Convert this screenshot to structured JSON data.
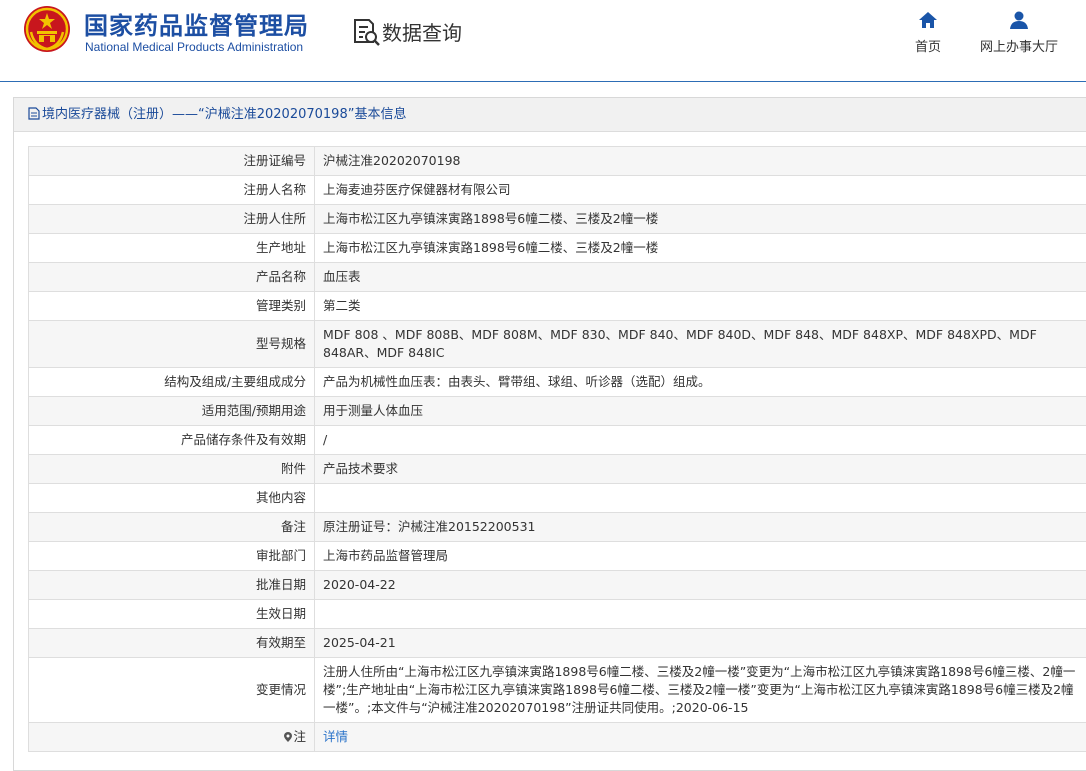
{
  "header": {
    "brand_cn": "国家药品监督管理局",
    "brand_en": "National Medical Products Administration",
    "query_title": "数据查询",
    "nav": [
      {
        "label": "首页",
        "icon": "home-icon"
      },
      {
        "label": "网上办事大厅",
        "icon": "user-icon"
      }
    ]
  },
  "panel": {
    "title": "境内医疗器械（注册）——“沪械注准20202070198”基本信息",
    "title_icon": "document-icon"
  },
  "rows": [
    {
      "label": "注册证编号",
      "value": "沪械注准20202070198"
    },
    {
      "label": "注册人名称",
      "value": "上海麦迪芬医疗保健器材有限公司"
    },
    {
      "label": "注册人住所",
      "value": "上海市松江区九亭镇涞寅路1898号6幢二楼、三楼及2幢一楼"
    },
    {
      "label": "生产地址",
      "value": "上海市松江区九亭镇涞寅路1898号6幢二楼、三楼及2幢一楼"
    },
    {
      "label": "产品名称",
      "value": "血压表"
    },
    {
      "label": "管理类别",
      "value": "第二类"
    },
    {
      "label": "型号规格",
      "value": "MDF 808 、MDF 808B、MDF 808M、MDF 830、MDF 840、MDF 840D、MDF 848、MDF 848XP、MDF 848XPD、MDF 848AR、MDF 848IC"
    },
    {
      "label": "结构及组成/主要组成成分",
      "value": "产品为机械性血压表：由表头、臂带组、球组、听诊器（选配）组成。"
    },
    {
      "label": "适用范围/预期用途",
      "value": "用于测量人体血压"
    },
    {
      "label": "产品储存条件及有效期",
      "value": "/"
    },
    {
      "label": "附件",
      "value": "产品技术要求"
    },
    {
      "label": "其他内容",
      "value": ""
    },
    {
      "label": "备注",
      "value": "原注册证号：沪械注准20152200531"
    },
    {
      "label": "审批部门",
      "value": "上海市药品监督管理局"
    },
    {
      "label": "批准日期",
      "value": "2020-04-22"
    },
    {
      "label": "生效日期",
      "value": ""
    },
    {
      "label": "有效期至",
      "value": "2025-04-21"
    },
    {
      "label": "变更情况",
      "value": "注册人住所由“上海市松江区九亭镇涞寅路1898号6幢二楼、三楼及2幢一楼”变更为“上海市松江区九亭镇涞寅路1898号6幢三楼、2幢一楼”;生产地址由“上海市松江区九亭镇涞寅路1898号6幢二楼、三楼及2幢一楼”变更为“上海市松江区九亭镇涞寅路1898号6幢三楼及2幢一楼”。;本文件与“沪械注准20202070198”注册证共同使用。;2020-06-15"
    }
  ],
  "note": {
    "label": "注",
    "link": "详情",
    "icon": "pin-icon"
  },
  "colors": {
    "brand": "#1d4fa3",
    "link": "#2a73c9",
    "row_alt": "#f6f6f6"
  }
}
